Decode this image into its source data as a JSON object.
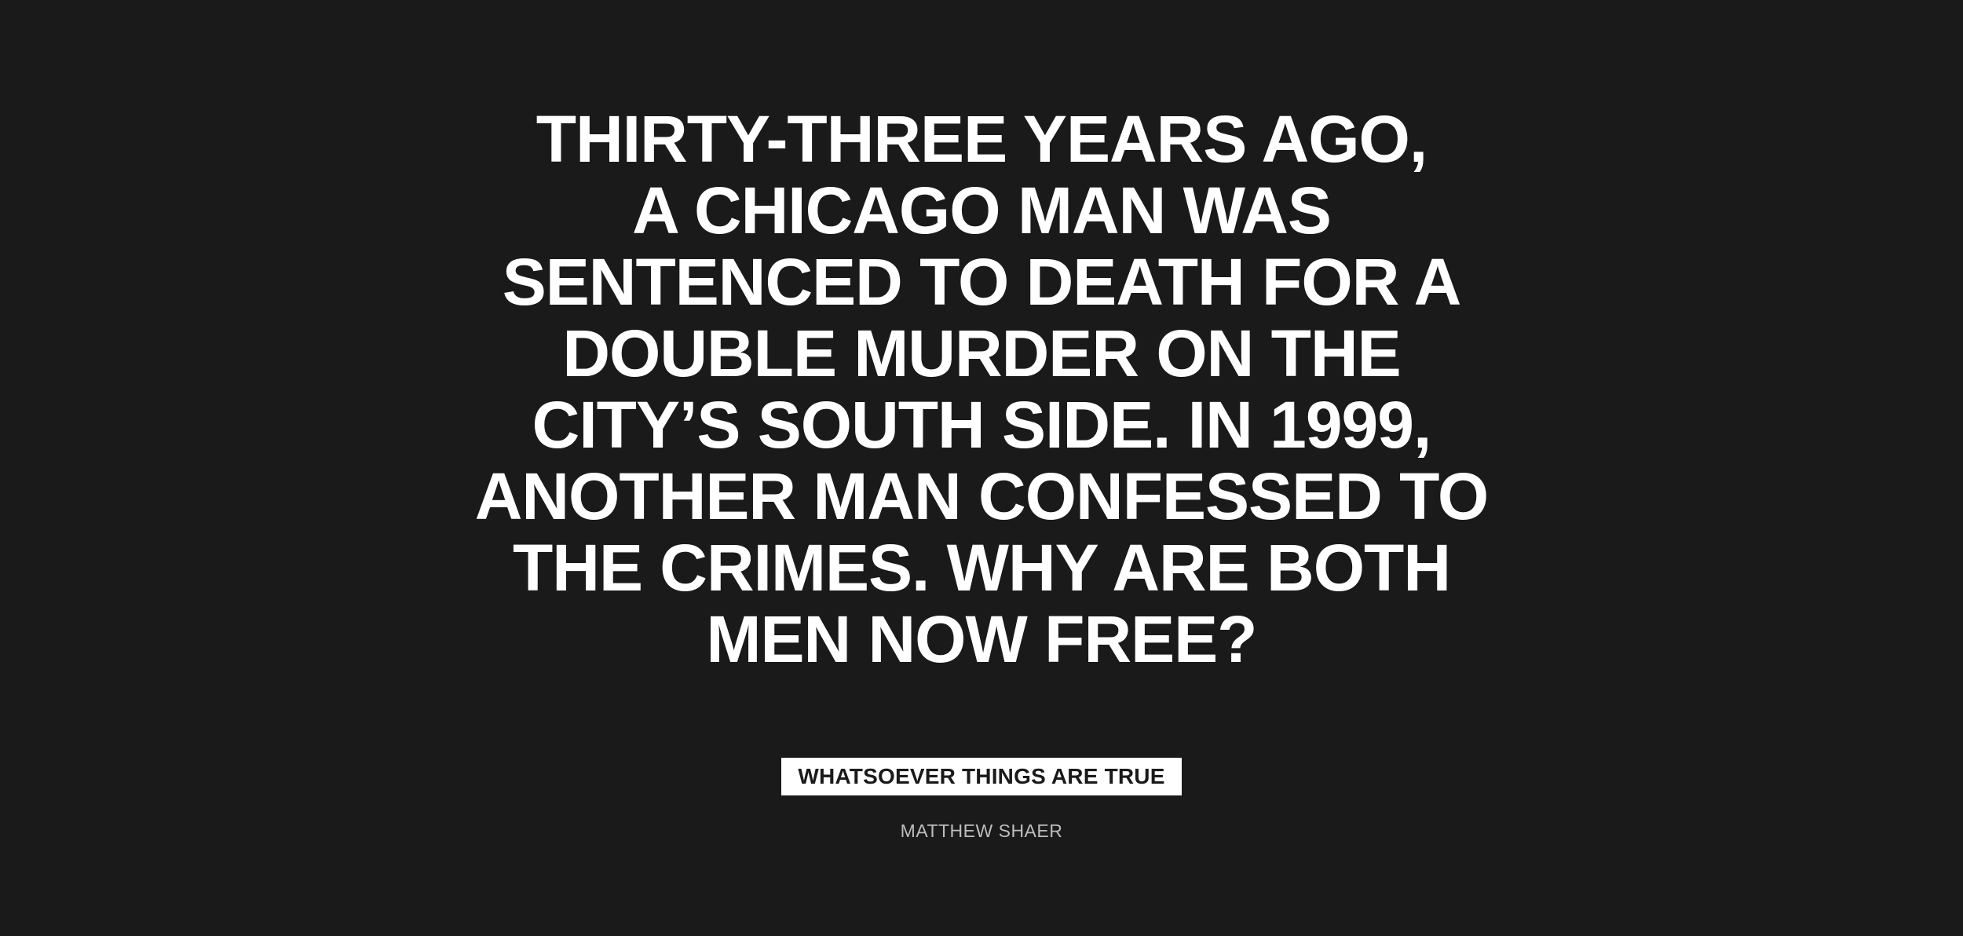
{
  "headline": {
    "lines": [
      "THIRTY-THREE YEARS AGO,",
      "A CHICAGO MAN WAS",
      "SENTENCED TO DEATH FOR A",
      "DOUBLE MURDER ON THE",
      "CITY’S SOUTH SIDE. IN 1999,",
      "ANOTHER MAN CONFESSED TO",
      "THE CRIMES. WHY ARE BOTH",
      "MEN NOW FREE?"
    ]
  },
  "section_tag": "WHATSOEVER THINGS ARE TRUE",
  "byline": "MATTHEW SHAER",
  "colors": {
    "background": "#1a1a1a",
    "text": "#ffffff",
    "byline": "#bdbdbd"
  }
}
